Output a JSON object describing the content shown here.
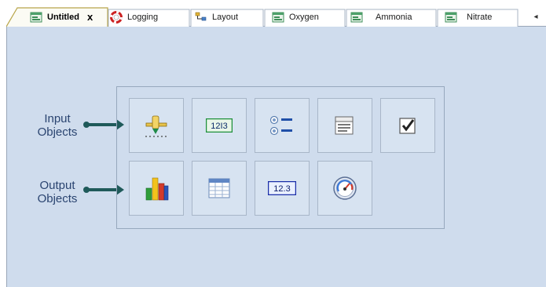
{
  "tabs": [
    {
      "label": "Untitled",
      "close": "x",
      "icon": "form-icon",
      "active": true
    },
    {
      "label": "Logging",
      "icon": "lifebuoy-icon"
    },
    {
      "label": "Layout",
      "icon": "layout-tree-icon"
    },
    {
      "label": "Oxygen",
      "icon": "form-icon"
    },
    {
      "label": "Ammonia",
      "icon": "form-icon"
    },
    {
      "label": "Nitrate",
      "icon": "form-icon"
    }
  ],
  "tab_scroll": "◂",
  "labels": {
    "input": [
      "Input",
      "Objects"
    ],
    "output": [
      "Output",
      "Objects"
    ]
  },
  "input_objects": [
    {
      "name": "slider-control",
      "icon": "slider-icon"
    },
    {
      "name": "numeric-input",
      "icon": "numeric-input-icon",
      "text": "12I3"
    },
    {
      "name": "option-list",
      "icon": "radio-list-icon"
    },
    {
      "name": "dropdown-list",
      "icon": "list-box-icon"
    },
    {
      "name": "checkbox",
      "icon": "checkbox-icon"
    }
  ],
  "output_objects": [
    {
      "name": "bar-chart",
      "icon": "bar-chart-icon"
    },
    {
      "name": "data-table",
      "icon": "table-icon"
    },
    {
      "name": "numeric-display",
      "icon": "numeric-display-icon",
      "text": "12.3"
    },
    {
      "name": "gauge",
      "icon": "gauge-icon"
    }
  ],
  "colors": {
    "canvas": "#cfdced",
    "label_text": "#2a4470",
    "arrow": "#1f5a5a"
  }
}
